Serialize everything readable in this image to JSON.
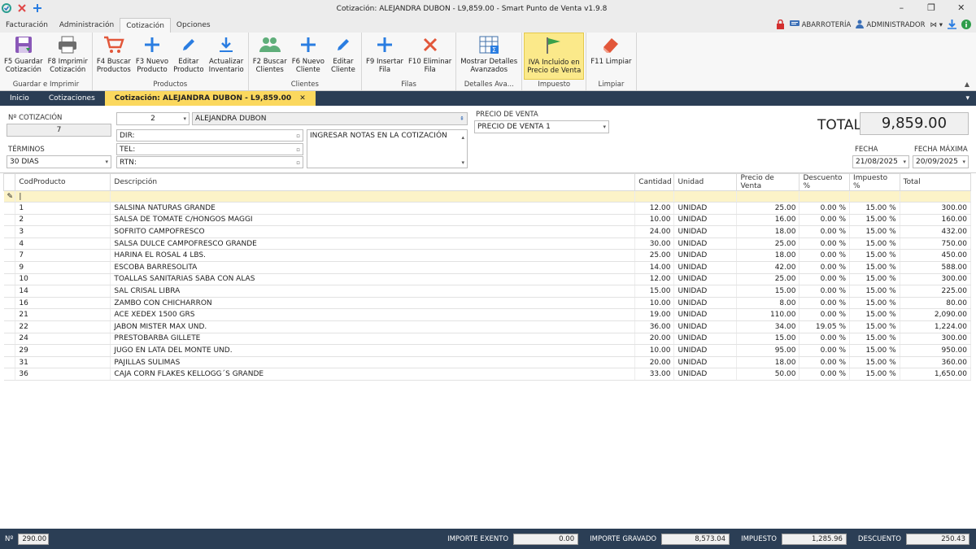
{
  "window": {
    "title": "Cotización: ALEJANDRA DUBON - L9,859.00 - Smart Punto de Venta v1.9.8"
  },
  "menu": {
    "tabs": [
      "Facturación",
      "Administración",
      "Cotización",
      "Opciones"
    ],
    "active": "Cotización",
    "store": "ABARROTERÍA",
    "user": "ADMINISTRADOR"
  },
  "ribbon": {
    "groups": [
      {
        "label": "Guardar e Imprimir",
        "buttons": [
          {
            "label": "F5 Guardar\nCotización",
            "icon": "save-icon"
          },
          {
            "label": "F8 Imprimir\nCotización",
            "icon": "printer-icon"
          }
        ]
      },
      {
        "label": "Productos",
        "buttons": [
          {
            "label": "F4 Buscar\nProductos",
            "icon": "cart-icon"
          },
          {
            "label": "F3 Nuevo\nProducto",
            "icon": "plus-icon"
          },
          {
            "label": "Editar\nProducto",
            "icon": "pencil-icon"
          },
          {
            "label": "Actualizar\nInventario",
            "icon": "download-icon"
          }
        ]
      },
      {
        "label": "Clientes",
        "buttons": [
          {
            "label": "F2 Buscar\nClientes",
            "icon": "users-icon"
          },
          {
            "label": "F6 Nuevo\nCliente",
            "icon": "plus-icon"
          },
          {
            "label": "Editar\nCliente",
            "icon": "pencil-icon"
          }
        ]
      },
      {
        "label": "Filas",
        "buttons": [
          {
            "label": "F9 Insertar\nFila",
            "icon": "plus-icon"
          },
          {
            "label": "F10 Eliminar\nFila",
            "icon": "x-icon"
          }
        ]
      },
      {
        "label": "Detalles Ava...",
        "buttons": [
          {
            "label": "Mostrar Detalles\nAvanzados",
            "icon": "table-sum-icon"
          }
        ]
      },
      {
        "label": "Impuesto",
        "buttons": [
          {
            "label": "IVA Incluido en\nPrecio de Venta",
            "icon": "flag-icon",
            "highlight": true
          }
        ]
      },
      {
        "label": "Limpiar",
        "buttons": [
          {
            "label": "F11 Limpiar",
            "icon": "eraser-icon"
          }
        ]
      }
    ]
  },
  "doctabs": {
    "inicio": "Inicio",
    "cotizaciones": "Cotizaciones",
    "active": "Cotización: ALEJANDRA DUBON - L9,859.00"
  },
  "form": {
    "no_cotizacion_label": "Nº COTIZACIÓN",
    "no_cotizacion": "7",
    "terminos_label": "TÉRMINOS",
    "terminos": "30 DIAS",
    "cliente_id": "2",
    "cliente_nombre": "ALEJANDRA DUBON",
    "dir_label": "DIR:",
    "tel_label": "TEL:",
    "rtn_label": "RTN:",
    "notas_placeholder": "INGRESAR NOTAS EN LA COTIZACIÓN",
    "precio_venta_label": "PRECIO DE VENTA",
    "precio_venta": "PRECIO DE VENTA 1",
    "total_label": "TOTAL",
    "total": "9,859.00",
    "fecha_label": "FECHA",
    "fecha": "21/08/2025",
    "fecha_max_label": "FECHA MÁXIMA",
    "fecha_max": "20/09/2025"
  },
  "grid": {
    "headers": [
      "CodProducto",
      "Descripción",
      "Cantidad",
      "Unidad",
      "Precio de Venta",
      "Descuento %",
      "Impuesto %",
      "Total"
    ],
    "rows": [
      [
        "1",
        "SALSINA NATURAS GRANDE",
        "12.00",
        "UNIDAD",
        "25.00",
        "0.00 %",
        "15.00 %",
        "300.00"
      ],
      [
        "2",
        "SALSA DE TOMATE C/HONGOS MAGGI",
        "10.00",
        "UNIDAD",
        "16.00",
        "0.00 %",
        "15.00 %",
        "160.00"
      ],
      [
        "3",
        "SOFRITO CAMPOFRESCO",
        "24.00",
        "UNIDAD",
        "18.00",
        "0.00 %",
        "15.00 %",
        "432.00"
      ],
      [
        "4",
        "SALSA DULCE CAMPOFRESCO GRANDE",
        "30.00",
        "UNIDAD",
        "25.00",
        "0.00 %",
        "15.00 %",
        "750.00"
      ],
      [
        "7",
        "HARINA EL ROSAL 4 LBS.",
        "25.00",
        "UNIDAD",
        "18.00",
        "0.00 %",
        "15.00 %",
        "450.00"
      ],
      [
        "9",
        "ESCOBA BARRESOLITA",
        "14.00",
        "UNIDAD",
        "42.00",
        "0.00 %",
        "15.00 %",
        "588.00"
      ],
      [
        "10",
        "TOALLAS SANITARIAS SABA CON ALAS",
        "12.00",
        "UNIDAD",
        "25.00",
        "0.00 %",
        "15.00 %",
        "300.00"
      ],
      [
        "14",
        "SAL CRISAL LIBRA",
        "15.00",
        "UNIDAD",
        "15.00",
        "0.00 %",
        "15.00 %",
        "225.00"
      ],
      [
        "16",
        "ZAMBO CON CHICHARRON",
        "10.00",
        "UNIDAD",
        "8.00",
        "0.00 %",
        "15.00 %",
        "80.00"
      ],
      [
        "21",
        "ACE XEDEX 1500 GRS",
        "19.00",
        "UNIDAD",
        "110.00",
        "0.00 %",
        "15.00 %",
        "2,090.00"
      ],
      [
        "22",
        "JABON MISTER MAX UND.",
        "36.00",
        "UNIDAD",
        "34.00",
        "19.05 %",
        "15.00 %",
        "1,224.00"
      ],
      [
        "24",
        "PRESTOBARBA GILLETE",
        "20.00",
        "UNIDAD",
        "15.00",
        "0.00 %",
        "15.00 %",
        "300.00"
      ],
      [
        "29",
        "JUGO EN LATA DEL MONTE UND.",
        "10.00",
        "UNIDAD",
        "95.00",
        "0.00 %",
        "15.00 %",
        "950.00"
      ],
      [
        "31",
        "PAJILLAS SULIMAS",
        "20.00",
        "UNIDAD",
        "18.00",
        "0.00 %",
        "15.00 %",
        "360.00"
      ],
      [
        "36",
        "CAJA CORN FLAKES KELLOGG´S GRANDE",
        "33.00",
        "UNIDAD",
        "50.00",
        "0.00 %",
        "15.00 %",
        "1,650.00"
      ]
    ]
  },
  "status": {
    "count_label": "Nº",
    "count": "290.00",
    "exento_label": "IMPORTE EXENTO",
    "exento": "0.00",
    "gravado_label": "IMPORTE GRAVADO",
    "gravado": "8,573.04",
    "impuesto_label": "IMPUESTO",
    "impuesto": "1,285.96",
    "descuento_label": "DESCUENTO",
    "descuento": "250.43"
  }
}
